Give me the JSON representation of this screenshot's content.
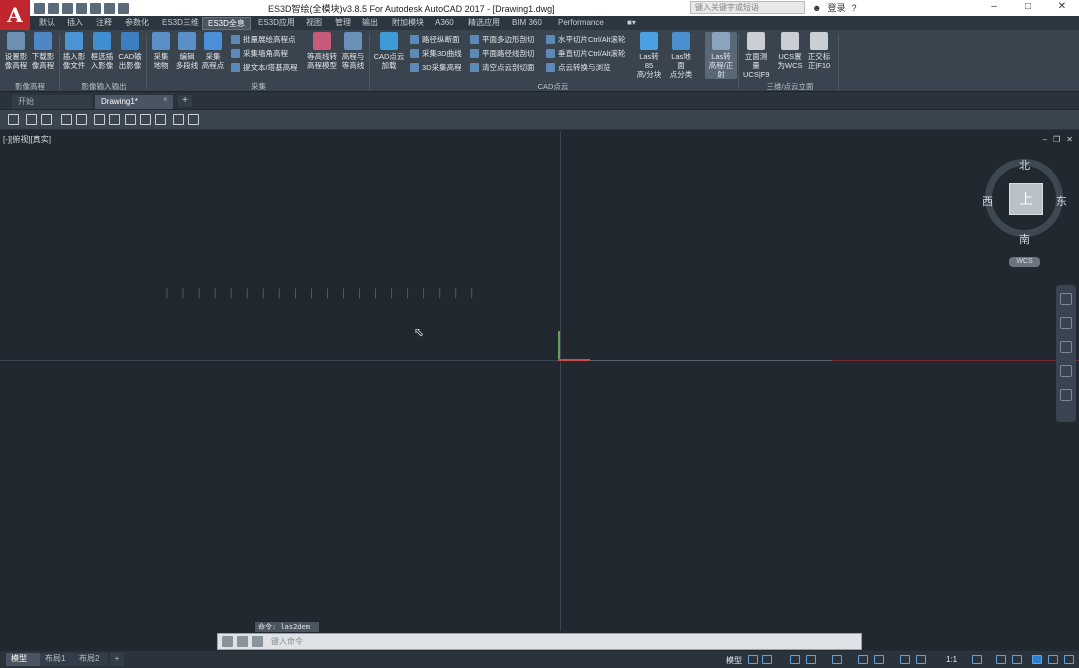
{
  "app": {
    "logo": "A",
    "title": "ES3D智绘(全模块)v3.8.5 For Autodesk AutoCAD 2017 - [Drawing1.dwg]",
    "search_placeholder": "键入关键字或短语",
    "login": "登录"
  },
  "ribbon_tabs": [
    "默认",
    "插入",
    "注释",
    "参数化",
    "ES3D三维",
    "ES3D全息",
    "ES3D应用",
    "视图",
    "管理",
    "输出",
    "附加模块",
    "A360",
    "精选应用",
    "BIM 360",
    "Performance"
  ],
  "active_tab": "ES3D全息",
  "ribbon": {
    "big_buttons": [
      {
        "l1": "设置影",
        "l2": "像高程",
        "color": "#6d8fb3"
      },
      {
        "l1": "下载影",
        "l2": "像高程",
        "color": "#4f86c6"
      },
      {
        "l1": "插入影",
        "l2": "像文件",
        "color": "#4a93d4"
      },
      {
        "l1": "框选插",
        "l2": "入影像",
        "color": "#3f8fd0"
      },
      {
        "l1": "CAD输",
        "l2": "出影像",
        "color": "#3d7fc0"
      },
      {
        "l1": "采集",
        "l2": "地物",
        "color": "#5b8fc8"
      },
      {
        "l1": "编辑",
        "l2": "多段线",
        "color": "#5b8fc8"
      },
      {
        "l1": "采集",
        "l2": "高程点",
        "color": "#4a8fd8"
      },
      {
        "l1": "等高线转",
        "l2": "高程模型",
        "color": "#c85a7a"
      },
      {
        "l1": "高程与",
        "l2": "等高线",
        "color": "#6a8fb8"
      },
      {
        "l1": "CAD点云",
        "l2": "加载",
        "color": "#3f9ad8"
      },
      {
        "l1": "Las转85",
        "l2": "高/分块",
        "color": "#4aa0e0"
      },
      {
        "l1": "Las地面",
        "l2": "点分类",
        "color": "#4a90d0"
      },
      {
        "l1": "Las转",
        "l2": "高程/正射",
        "color": "#8aa4be"
      },
      {
        "l1": "立面测量",
        "l2": "UCS|F9",
        "color": "#c9cfd5"
      },
      {
        "l1": "UCS置",
        "l2": "为WCS",
        "color": "#c9cfd5"
      },
      {
        "l1": "正交标",
        "l2": "正|F10",
        "color": "#c9cfd5"
      }
    ],
    "small_buttons": [
      "批量展绘高程点",
      "采集墙角高程",
      "提文本/塔基高程",
      "路径纵断面",
      "采集3D曲线",
      "3D采集高程",
      "平面多边形剖切",
      "平面路径线剖切",
      "清空点云剖切面",
      "水平切片Ctrl/Alt滚轮",
      "垂直切片Ctrl/Alt滚轮",
      "点云转换与浏览"
    ],
    "panels": [
      "影像高程",
      "影像输入输出",
      "采集",
      "CAD点云",
      "三维/点云立面"
    ]
  },
  "file_tabs": [
    "开始",
    "Drawing1*"
  ],
  "viewport": {
    "label": "[-][俯视][真实]",
    "compass": {
      "north": "北",
      "south": "南",
      "east": "东",
      "west": "西",
      "top": "上"
    },
    "ucs": "WCS",
    "ticks": "| | | | | | | | | | | | | | | | | | | |"
  },
  "command": {
    "history": "命令: las2dem",
    "placeholder": "键入命令"
  },
  "status": {
    "layout_tabs": [
      "模型",
      "布局1",
      "布局2"
    ],
    "mode": "模型",
    "scale": "1:1"
  }
}
